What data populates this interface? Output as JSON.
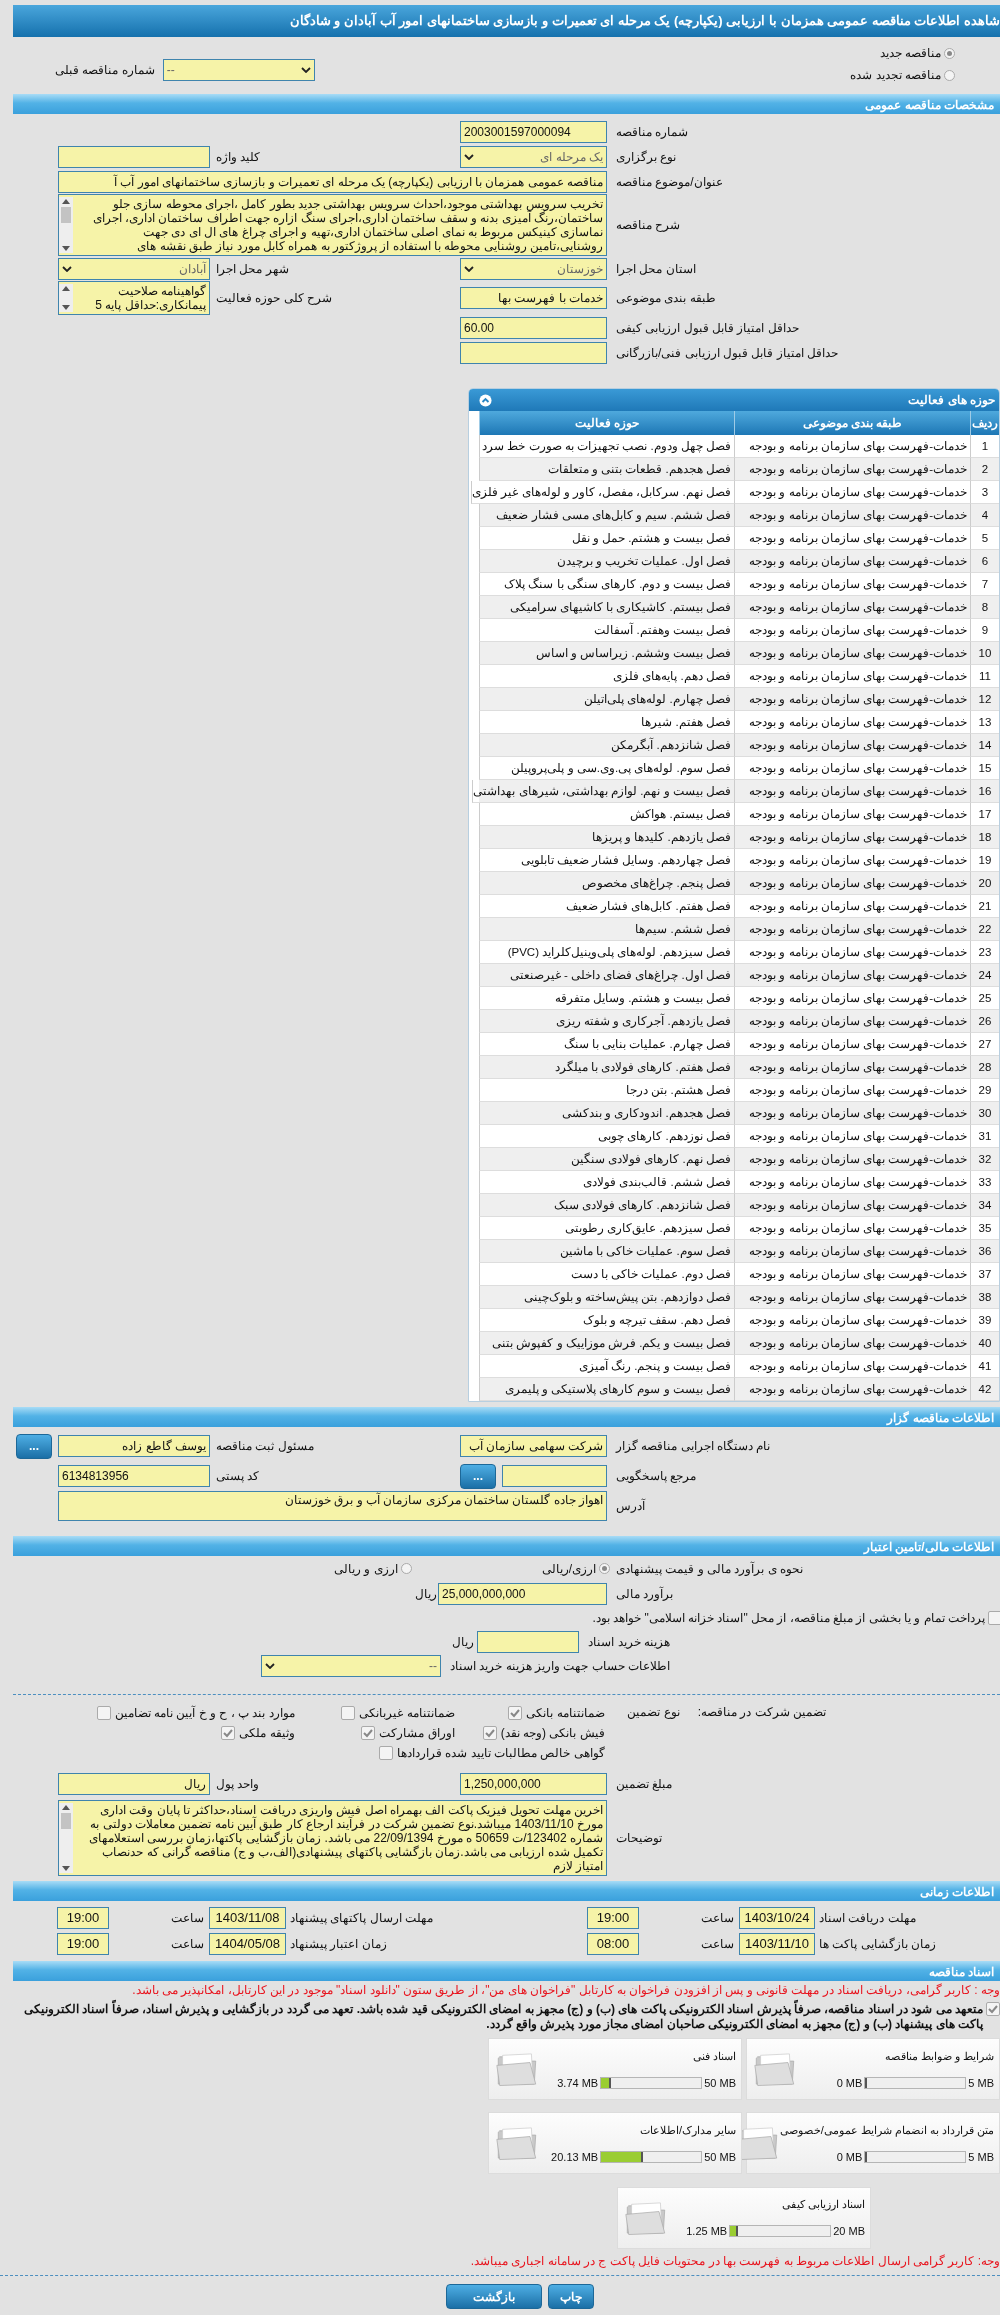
{
  "title": "شاهده اطلاعات مناقصه عمومی همزمان با ارزیابی (یکپارچه) یک مرحله ای تعمیرات و بازسازی ساختمانهای امور آب آبادان و شادگان",
  "tender_type": [
    {
      "label": "مناقصه جدید",
      "selected": true
    },
    {
      "label": "مناقصه تجدید شده",
      "selected": false
    }
  ],
  "previous_tender": {
    "label": "شماره مناقصه قبلی",
    "value": "--"
  },
  "general": {
    "header": "مشخصات مناقصه عمومی",
    "rows": [
      {
        "right": {
          "label": "شماره مناقصه",
          "value": "2003001597000094",
          "kind": "number"
        }
      },
      {
        "right": {
          "label": "نوع برگزاری",
          "value": "یک مرحله ای",
          "kind": "select"
        },
        "left": {
          "label": "کلید واژه",
          "kind": "text"
        }
      },
      {
        "right": {
          "label": "عنوان/موضوع مناقصه",
          "value": "مناقصه عمومی همزمان با ارزیابی (یکپارچه) یک مرحله ای تعمیرات و بازسازی ساختمانهای امور آب آ",
          "kind": "wide_text"
        }
      },
      {
        "right": {
          "label": "شرح مناقصه",
          "value": "تخریب سرویس بهداشتی موجود،احداث سرویس بهداشتی جدید بطور کامل ،اجرای محوطه سازی جلو ساختمان،رنگ آمیزی بدنه و سقف ساختمان اداری،اجرای سنگ ازاره جهت اطراف ساختمان اداری، اجرای نماسازی کینیکس مربوط به نمای اصلی ساختمان اداری،تهیه و اجرای چراغ های ال ای دی جهت روشنایی،تامین روشنایی محوطه با استفاده از پروژکتور به همراه کابل مورد نیاز طبق نقشه های",
          "kind": "area"
        }
      },
      {
        "right": {
          "label": "استان محل اجرا",
          "value": "خوزستان",
          "kind": "select"
        },
        "left": {
          "label": "شهر محل اجرا",
          "value": "آبادان",
          "kind": "select"
        }
      },
      {
        "right": {
          "label": "طبقه بندی موضوعی",
          "value": "خدمات با فهرست بها",
          "kind": "text"
        },
        "left": {
          "label": "شرح کلی حوزه فعالیت",
          "value": "گواهینامه صلاحیت پیمانکاری:حداقل پایه 5",
          "kind": "area"
        }
      },
      {
        "right": {
          "label": "حداقل امتیاز قابل قبول ارزیابی کیفی",
          "value": "60.00",
          "kind": "number"
        }
      },
      {
        "right": {
          "label": "حداقل امتیاز قابل قبول ارزیابی فنی/بازرگانی",
          "kind": "number"
        }
      }
    ]
  },
  "activities": {
    "title": "حوزه های فعالیت",
    "columns": [
      "ردیف",
      "طبقه بندی موضوعی",
      "حوزه فعالیت"
    ],
    "rows": [
      {
        "no": "1",
        "category": "خدمات-فهرست بهای سازمان برنامه و بودجه",
        "activity": "فصل چهل ودوم. نصب تجهیزات به صورت خط سرد"
      },
      {
        "no": "2",
        "category": "خدمات-فهرست بهای سازمان برنامه و بودجه",
        "activity": "فصل هجدهم. قطعات بتنی و متعلقات"
      },
      {
        "no": "3",
        "category": "خدمات-فهرست بهای سازمان برنامه و بودجه",
        "activity": "فصل نهم. سرکابل، مفصل، کاور و لوله‌های غیر فلزی"
      },
      {
        "no": "4",
        "category": "خدمات-فهرست بهای سازمان برنامه و بودجه",
        "activity": "فصل ششم. سیم و کابل‌های مسی فشار ضعیف"
      },
      {
        "no": "5",
        "category": "خدمات-فهرست بهای سازمان برنامه و بودجه",
        "activity": "فصل بیست و هشتم. حمل و نقل"
      },
      {
        "no": "6",
        "category": "خدمات-فهرست بهای سازمان برنامه و بودجه",
        "activity": "فصل اول. عملیات تخریب و برچیدن"
      },
      {
        "no": "7",
        "category": "خدمات-فهرست بهای سازمان برنامه و بودجه",
        "activity": "فصل بیست و دوم. کارهای سنگی با سنگ پلاک"
      },
      {
        "no": "8",
        "category": "خدمات-فهرست بهای سازمان برنامه و بودجه",
        "activity": "فصل بیستم. کاشیکاری با کاشیهای سرامیکی"
      },
      {
        "no": "9",
        "category": "خدمات-فهرست بهای سازمان برنامه و بودجه",
        "activity": "فصل بیست وهفتم. آسفالت"
      },
      {
        "no": "10",
        "category": "خدمات-فهرست بهای سازمان برنامه و بودجه",
        "activity": "فصل بیست وششم. زیراساس و اساس"
      },
      {
        "no": "11",
        "category": "خدمات-فهرست بهای سازمان برنامه و بودجه",
        "activity": "فصل دهم. پایه‌های فلزی"
      },
      {
        "no": "12",
        "category": "خدمات-فهرست بهای سازمان برنامه و بودجه",
        "activity": "فصل چهارم. لوله‌های پلی‌اتیلن"
      },
      {
        "no": "13",
        "category": "خدمات-فهرست بهای سازمان برنامه و بودجه",
        "activity": "فصل هفتم. شیرها"
      },
      {
        "no": "14",
        "category": "خدمات-فهرست بهای سازمان برنامه و بودجه",
        "activity": "فصل شانزدهم. آبگرمکن"
      },
      {
        "no": "15",
        "category": "خدمات-فهرست بهای سازمان برنامه و بودجه",
        "activity": "فصل سوم. لوله‌های پی.وی.سی و پلی‌پروپیلن"
      },
      {
        "no": "16",
        "category": "خدمات-فهرست بهای سازمان برنامه و بودجه",
        "activity": "فصل بیست و نهم. لوازم بهداشتی، شیرهای بهداشتی"
      },
      {
        "no": "17",
        "category": "خدمات-فهرست بهای سازمان برنامه و بودجه",
        "activity": "فصل بیستم. هواکش"
      },
      {
        "no": "18",
        "category": "خدمات-فهرست بهای سازمان برنامه و بودجه",
        "activity": "فصل یازدهم. کلیدها و پریزها"
      },
      {
        "no": "19",
        "category": "خدمات-فهرست بهای سازمان برنامه و بودجه",
        "activity": "فصل چهاردهم. وسایل فشار ضعیف تابلویی"
      },
      {
        "no": "20",
        "category": "خدمات-فهرست بهای سازمان برنامه و بودجه",
        "activity": "فصل پنجم. چراغ‌های مخصوص"
      },
      {
        "no": "21",
        "category": "خدمات-فهرست بهای سازمان برنامه و بودجه",
        "activity": "فصل هفتم. کابل‌های فشار ضعیف"
      },
      {
        "no": "22",
        "category": "خدمات-فهرست بهای سازمان برنامه و بودجه",
        "activity": "فصل ششم. سیم‌ها"
      },
      {
        "no": "23",
        "category": "خدمات-فهرست بهای سازمان برنامه و بودجه",
        "activity": "فصل سیزدهم. لوله‌های پلی‌وینیل‌کلراید (PVC)"
      },
      {
        "no": "24",
        "category": "خدمات-فهرست بهای سازمان برنامه و بودجه",
        "activity": "فصل اول. چراغ‌های فضای داخلی - غیرصنعتی"
      },
      {
        "no": "25",
        "category": "خدمات-فهرست بهای سازمان برنامه و بودجه",
        "activity": "فصل بیست و هشتم. وسایل متفرقه"
      },
      {
        "no": "26",
        "category": "خدمات-فهرست بهای سازمان برنامه و بودجه",
        "activity": "فصل یازدهم. آجرکاری و شفته ریزی"
      },
      {
        "no": "27",
        "category": "خدمات-فهرست بهای سازمان برنامه و بودجه",
        "activity": "فصل چهارم. عملیات بنایی با سنگ"
      },
      {
        "no": "28",
        "category": "خدمات-فهرست بهای سازمان برنامه و بودجه",
        "activity": "فصل هفتم. کارهای فولادی با میلگرد"
      },
      {
        "no": "29",
        "category": "خدمات-فهرست بهای سازمان برنامه و بودجه",
        "activity": "فصل هشتم. بتن درجا"
      },
      {
        "no": "30",
        "category": "خدمات-فهرست بهای سازمان برنامه و بودجه",
        "activity": "فصل هجدهم. اندودکاری و بندکشی"
      },
      {
        "no": "31",
        "category": "خدمات-فهرست بهای سازمان برنامه و بودجه",
        "activity": "فصل نوزدهم. کارهای چوبی"
      },
      {
        "no": "32",
        "category": "خدمات-فهرست بهای سازمان برنامه و بودجه",
        "activity": "فصل نهم. کارهای فولادی سنگین"
      },
      {
        "no": "33",
        "category": "خدمات-فهرست بهای سازمان برنامه و بودجه",
        "activity": "فصل ششم. قالب‌بندی فولادی"
      },
      {
        "no": "34",
        "category": "خدمات-فهرست بهای سازمان برنامه و بودجه",
        "activity": "فصل شانزدهم. کارهای فولادی سبک"
      },
      {
        "no": "35",
        "category": "خدمات-فهرست بهای سازمان برنامه و بودجه",
        "activity": "فصل سیزدهم. عایق‌کاری رطوبتی"
      },
      {
        "no": "36",
        "category": "خدمات-فهرست بهای سازمان برنامه و بودجه",
        "activity": "فصل سوم. عملیات خاکی با ماشین"
      },
      {
        "no": "37",
        "category": "خدمات-فهرست بهای سازمان برنامه و بودجه",
        "activity": "فصل دوم. عملیات خاکی با دست"
      },
      {
        "no": "38",
        "category": "خدمات-فهرست بهای سازمان برنامه و بودجه",
        "activity": "فصل دوازدهم. بتن پیش‌ساخته و بلوک‌چینی"
      },
      {
        "no": "39",
        "category": "خدمات-فهرست بهای سازمان برنامه و بودجه",
        "activity": "فصل دهم. سقف تیرچه و بلوک"
      },
      {
        "no": "40",
        "category": "خدمات-فهرست بهای سازمان برنامه و بودجه",
        "activity": "فصل بیست و یکم. فرش موزاییک و کفپوش بتنی"
      },
      {
        "no": "41",
        "category": "خدمات-فهرست بهای سازمان برنامه و بودجه",
        "activity": "فصل بیست و پنجم. رنگ آمیزی"
      },
      {
        "no": "42",
        "category": "خدمات-فهرست بهای سازمان برنامه و بودجه",
        "activity": "فصل بیست و سوم کارهای پلاستیکی و پلیمری"
      }
    ]
  },
  "organizer": {
    "header": "اطلاعات مناقصه گزار",
    "rows": [
      {
        "right": {
          "label": "نام دستگاه اجرایی مناقصه گزار",
          "value": "شرکت سهامی سازمان آب",
          "kind": "text"
        },
        "left": {
          "label": "مسئول ثبت مناقصه",
          "value": "یوسف گاطع زاده",
          "kind": "lookup",
          "button": "..."
        }
      },
      {
        "right": {
          "label": "مرجع پاسخگویی",
          "kind": "lookup",
          "button": "..."
        },
        "left": {
          "label": "کد پستی",
          "value": "6134813956",
          "kind": "number"
        }
      },
      {
        "right": {
          "label": "آدرس",
          "value": "اهواز جاده گلستان ساختمان مرکزی سازمان آب و برق خوزستان",
          "kind": "box"
        }
      }
    ]
  },
  "financial": {
    "header": "اطلاعات مالی/تامین اعتبار",
    "method": {
      "label": "نحوه ی برآورد مالی و قیمت پیشنهادی",
      "options": [
        {
          "label": "ارزی/ریالی",
          "selected": true
        },
        {
          "label": "ارزی و ریالی",
          "selected": false
        }
      ]
    },
    "estimate": {
      "label": "برآورد مالی",
      "value": "25,000,000,000",
      "unit": "ریال"
    },
    "treasury": {
      "label": "پرداخت تمام و یا بخشی از مبلغ مناقصه، از محل \"اسناد خزانه اسلامی\" خواهد بود.",
      "checked": false
    },
    "doc_fee": {
      "label": "هزینه خرید اسناد",
      "unit": "ریال"
    },
    "account": {
      "label": "اطلاعات حساب جهت واریز هزینه خرید اسناد",
      "value": "--"
    },
    "guarantee": {
      "label": "تضمین شرکت در مناقصه:",
      "type_label": "نوع تضمین",
      "options": [
        {
          "label": "ضمانتنامه بانکی",
          "checked": true
        },
        {
          "label": "ضمانتنامه غیربانکی",
          "checked": false
        },
        {
          "label": "موارد بند پ ، ح و خ آیین نامه تضامین",
          "checked": false
        },
        {
          "label": "فیش بانکی (وجه نقد)",
          "checked": true
        },
        {
          "label": "اوراق مشارکت",
          "checked": true
        },
        {
          "label": "وثیقه ملکی",
          "checked": true
        },
        {
          "label": "گواهی خالص مطالبات تایید شده قراردادها",
          "checked": false
        }
      ]
    },
    "rows": [
      {
        "right": {
          "label": "مبلغ تضمین",
          "value": "1,250,000,000",
          "kind": "number"
        },
        "left": {
          "label": "واحد پول",
          "value": "ریال",
          "kind": "text"
        }
      },
      {
        "right": {
          "label": "توضیحات",
          "value": "اخرین مهلت تحویل فیزیک پاکت الف بهمراه اصل فیش واریزی دریافت اسناد،حداکثر تا پایان وقت اداری مورخ 1403/11/10 میباشد.نوع تضمین شرکت در فرآیند ارجاع کار طبق آیین نامه تضمین معاملات دولتی به شماره 123402/ت 50659 ه مورخ 22/09/1394 می باشد. زمان بازگشایی پاکتها،زمان بررسی استعلامهای تکمیل شده ارزیابی می باشد.زمان بازگشایی پاکتهای پیشنهادی(الف،ب و ج) مناقصه گرانی که حدنصاب امتیاز لازم",
          "kind": "area"
        }
      }
    ]
  },
  "timing": {
    "header": "اطلاعات زمانی",
    "items": [
      {
        "label": "مهلت دریافت اسناد",
        "date": "1403/10/24",
        "time_label": "ساعت",
        "time": "19:00"
      },
      {
        "label": "مهلت ارسال پاکتهای پیشنهاد",
        "date": "1403/11/08",
        "time_label": "ساعت",
        "time": "19:00"
      },
      {
        "label": "زمان بازگشایی پاکت ها",
        "date": "1403/11/10",
        "time_label": "ساعت",
        "time": "08:00"
      },
      {
        "label": "زمان اعتبار پیشنهاد",
        "date": "1404/05/08",
        "time_label": "ساعت",
        "time": "19:00"
      }
    ]
  },
  "documents": {
    "header": "اسناد مناقصه",
    "note": "وجه : کاربر گرامی، دریافت اسناد در مهلت قانونی و پس از افزودن فراخوان به کارتابل \"فراخوان های من\"، از طریق ستون \"دانلود اسناد\" موجود در این کارتابل، امکانپذیر می باشد.",
    "commitment": {
      "text": "متعهد می شود در اسناد مناقصه، صرفاً پذیرش اسناد الکترونیکی پاکت های (ب) و (ج) مجهز به امضای الکترونیکی قید شده باشد. تعهد می گردد در بازگشایی و پذیرش اسناد، صرفاً اسناد الکترونیکی پاکت های پیشنهاد (ب) و (ج) مجهز به امضای الکترونیکی صاحبان امضای مجاز مورد پذیرش واقع گردد.",
      "checked": true
    },
    "files": [
      {
        "name": "شرایط و ضوابط مناقصه",
        "used": "0 MB",
        "max": "5 MB",
        "level": 0
      },
      {
        "name": "اسناد فنی",
        "used": "3.74 MB",
        "max": "50 MB",
        "level": 0.075
      },
      {
        "name": "متن قرارداد به انضمام شرایط عمومی/خصوصی",
        "used": "0 MB",
        "max": "5 MB",
        "level": 0
      },
      {
        "name": "سایر مدارک/اطلاعات",
        "used": "20.13 MB",
        "max": "50 MB",
        "level": 0.4
      },
      {
        "name": "اسناد ارزیابی کیفی",
        "used": "1.25 MB",
        "max": "20 MB",
        "level": 0.0625
      }
    ],
    "footer_note": "وجه: کاربر گرامی ارسال اطلاعات مربوط به فهرست بها در محتویات فایل پاکت ج در سامانه اجباری میباشد."
  },
  "buttons": [
    "چاپ",
    "بازگشت"
  ]
}
